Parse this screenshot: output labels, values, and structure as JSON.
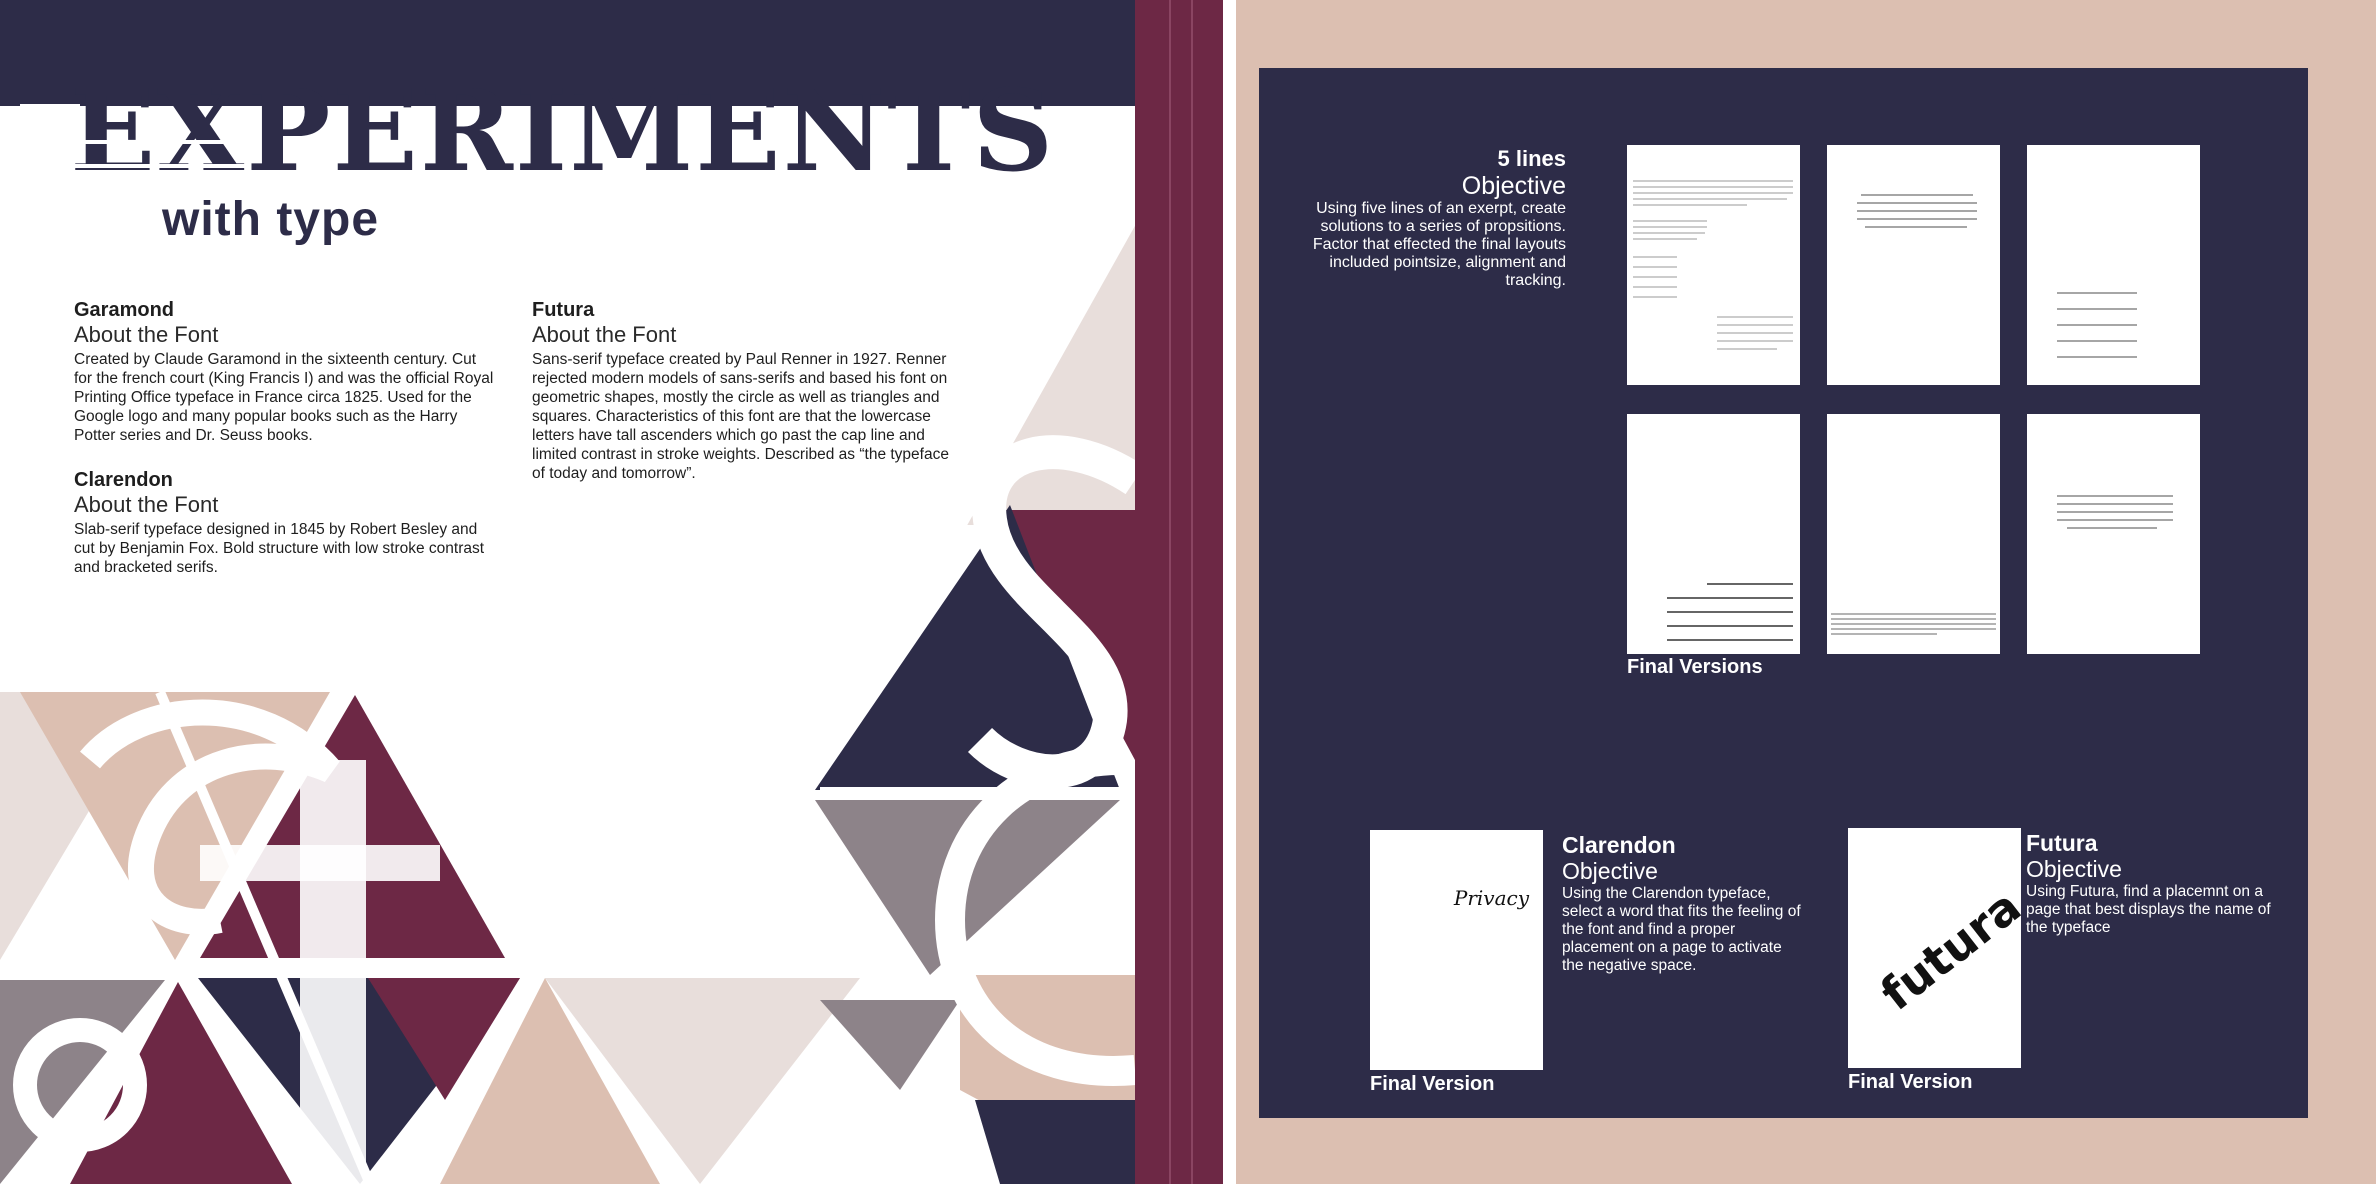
{
  "left_spread": {
    "title_main": "EXPERIMENTS",
    "title_sub": "with type",
    "garamond": {
      "name": "Garamond",
      "subtitle": "About the Font",
      "body": "Created by Claude Garamond in the sixteenth century. Cut for the french court (King Francis I) and was the official Royal Printing Office typeface in France circa 1825. Used for the Google logo and many popular books such as the Harry Potter series and Dr. Seuss books."
    },
    "futura": {
      "name": "Futura",
      "subtitle": "About the Font",
      "body": "Sans-serif typeface created by Paul Renner in 1927. Renner rejected modern models of sans-serifs and based his font on geometric shapes, mostly the circle as well as triangles and squares. Characteristics of this font are that the lowercase letters have tall ascenders which go past the cap line and limited contrast in stroke weights. Described as “the typeface of today and tomorrow”."
    },
    "clarendon": {
      "name": "Clarendon",
      "subtitle": "About the Font",
      "body": "Slab-serif typeface designed in 1845 by Robert Besley and cut by Benjamin Fox. Bold structure with low stroke contrast and bracketed serifs."
    }
  },
  "right_spread": {
    "five_lines": {
      "title": "5 lines",
      "subtitle": "Objective",
      "body": "Using five lines of an exerpt, create solutions to a series of propsitions. Factor that effected the final layouts included pointsize, alignment and tracking."
    },
    "final_versions_label": "Final Versions",
    "clarendon_project": {
      "name": "Clarendon",
      "subtitle": "Objective",
      "body": "Using the Clarendon typeface, select a word that fits the feeling of the font and find a proper placement on a page to activate the negative space.",
      "card_word": "Privacy",
      "final_label": "Final Version"
    },
    "futura_project": {
      "name": "Futura",
      "subtitle": "Objective",
      "body": "Using Futura, find a placemnt on a page that best displays the name of the typeface",
      "card_word": "futura",
      "final_label": "Final Version"
    }
  },
  "colors": {
    "navy": "#2d2c48",
    "maroon": "#6d2845",
    "blush": "#dcbfb1",
    "light_blush": "#e8dedb",
    "gray_mauve": "#8d8389"
  }
}
